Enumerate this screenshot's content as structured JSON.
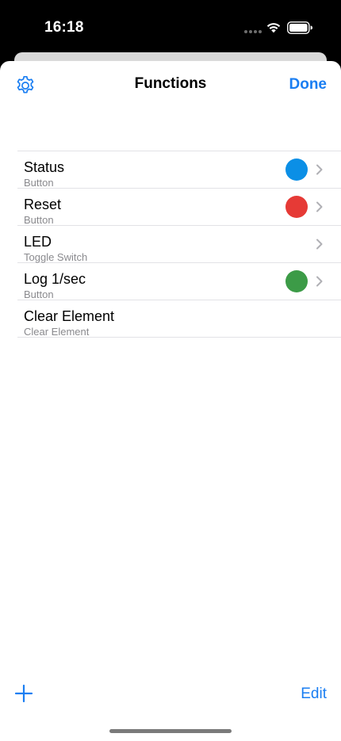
{
  "status_bar": {
    "time": "16:18"
  },
  "nav": {
    "settings_icon": "gear-icon",
    "title": "Functions",
    "done_label": "Done"
  },
  "functions": [
    {
      "title": "Status",
      "subtitle": "Button",
      "color": "#0b8fe6",
      "has_chevron": true
    },
    {
      "title": "Reset",
      "subtitle": "Button",
      "color": "#e63a36",
      "has_chevron": true
    },
    {
      "title": "LED",
      "subtitle": "Toggle Switch",
      "color": null,
      "has_chevron": true
    },
    {
      "title": "Log 1/sec",
      "subtitle": "Button",
      "color": "#3c9b47",
      "has_chevron": true
    },
    {
      "title": "Clear Element",
      "subtitle": "Clear Element",
      "color": null,
      "has_chevron": false
    }
  ],
  "toolbar": {
    "add_icon": "plus-icon",
    "edit_label": "Edit"
  },
  "colors": {
    "accent": "#1a7ef2",
    "separator": "#e2e2e6",
    "subtitle": "#8a8a8e"
  }
}
